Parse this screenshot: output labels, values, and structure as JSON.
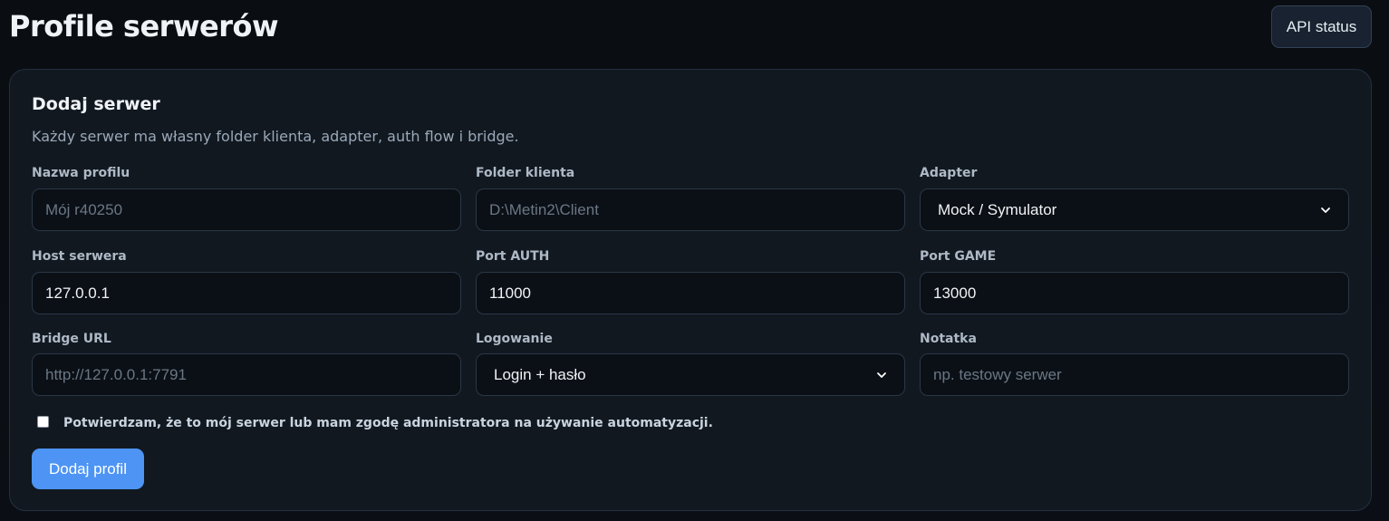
{
  "header": {
    "title": "Profile serwerów",
    "api_status_label": "API status"
  },
  "form": {
    "title": "Dodaj serwer",
    "subtitle": "Każdy serwer ma własny folder klienta, adapter, auth flow i bridge.",
    "fields": {
      "profile_name": {
        "label": "Nazwa profilu",
        "value": "",
        "placeholder": "Mój r40250"
      },
      "client_folder": {
        "label": "Folder klienta",
        "value": "",
        "placeholder": "D:\\Metin2\\Client"
      },
      "adapter": {
        "label": "Adapter",
        "selected": "Mock / Symulator"
      },
      "server_host": {
        "label": "Host serwera",
        "value": "127.0.0.1",
        "placeholder": ""
      },
      "auth_port": {
        "label": "Port AUTH",
        "value": "11000",
        "placeholder": ""
      },
      "game_port": {
        "label": "Port GAME",
        "value": "13000",
        "placeholder": ""
      },
      "bridge_url": {
        "label": "Bridge URL",
        "value": "",
        "placeholder": "http://127.0.0.1:7791"
      },
      "login_method": {
        "label": "Logowanie",
        "selected": "Login + hasło"
      },
      "note": {
        "label": "Notatka",
        "value": "",
        "placeholder": "np. testowy serwer"
      }
    },
    "consent": {
      "label": "Potwierdzam, że to mój serwer lub mam zgodę administratora na używanie automatyzacji.",
      "checked": false
    },
    "submit_label": "Dodaj profil"
  },
  "colors": {
    "background": "#0a0d12",
    "card": "#111820",
    "accent": "#4d94f4",
    "input_bg": "#0b1016"
  }
}
